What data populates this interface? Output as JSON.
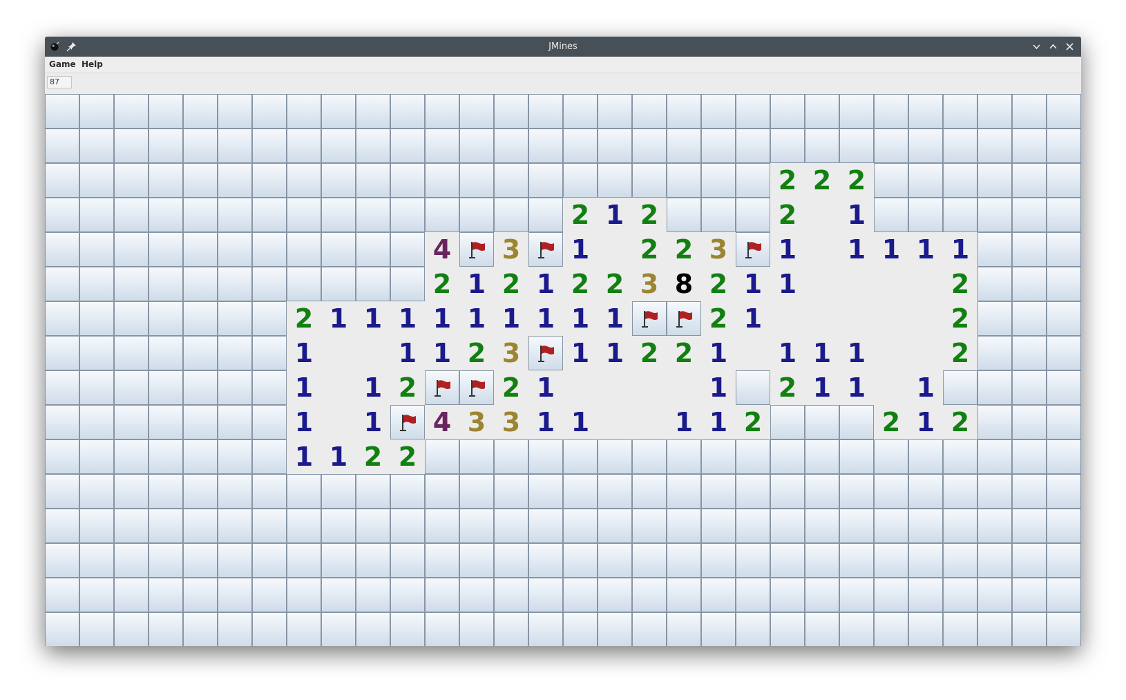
{
  "window": {
    "title": "JMines"
  },
  "menu": [
    {
      "label": "Game"
    },
    {
      "label": "Help"
    }
  ],
  "counter": {
    "value": "87"
  },
  "colors": {
    "1": "#1a1a8c",
    "2": "#118011",
    "3": "#9c8531",
    "4": "#6a2460",
    "flag": "#b02020"
  },
  "board": {
    "rows": 16,
    "cols": 30,
    "legend": {
      "#": "hidden",
      "F": "flag",
      ".": "empty",
      "1-8": "number"
    },
    "grid": [
      "##############################",
      "##############################",
      "#####################222######",
      "###############212###2.1######",
      "###########4F3F1.223F1.1111###",
      "###########21212238211....2###",
      "#######2111111111FF21.....2###",
      "#######1..1123F11221.111..2###",
      "#######1.12FF21....1#211.1###",
      "#######1.1F43311..112###212###",
      "#######1122#######################"
    ]
  }
}
